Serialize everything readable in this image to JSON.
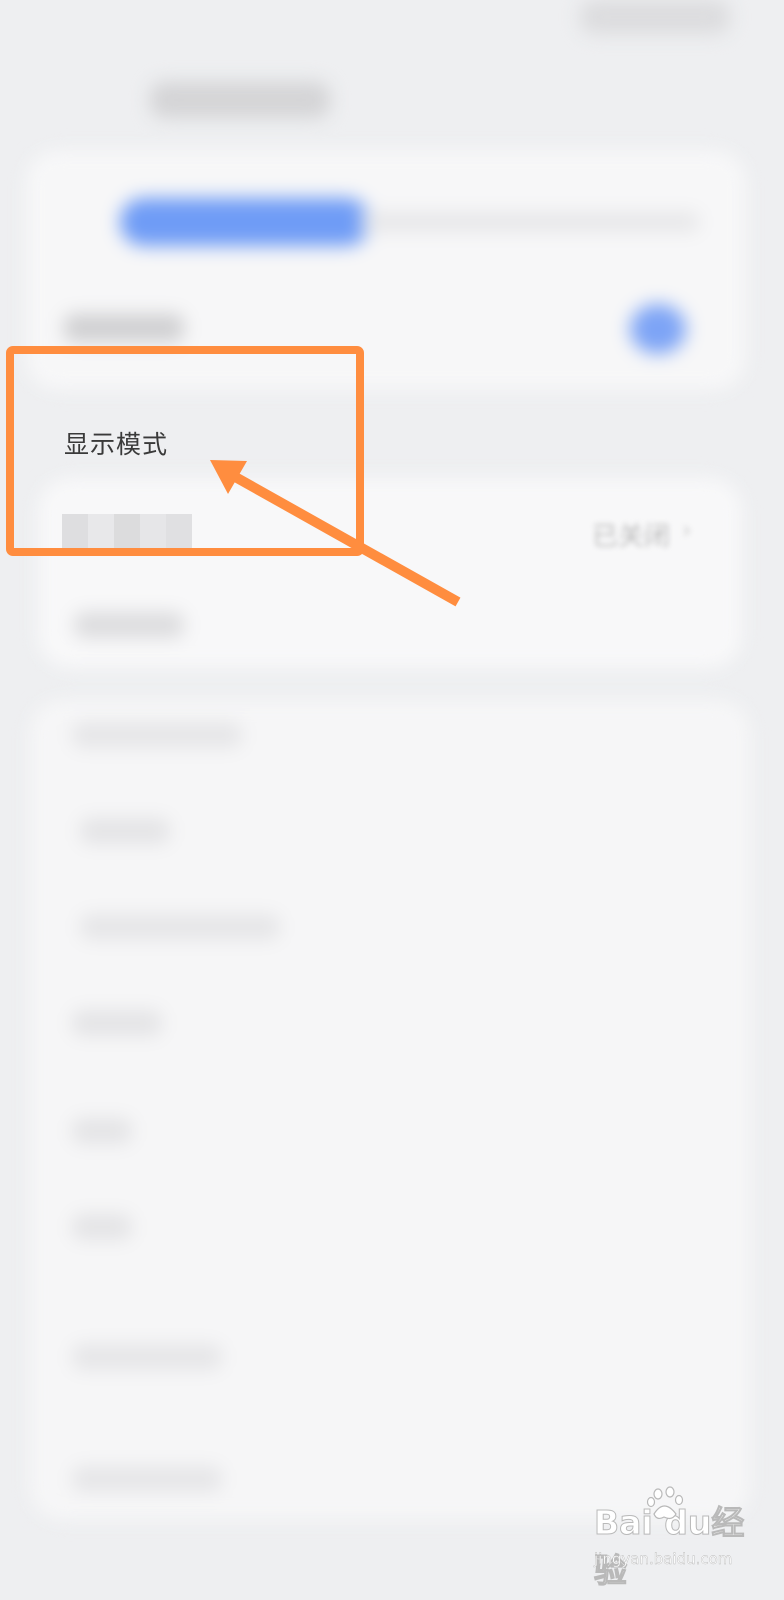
{
  "settings": {
    "section_title": "显示模式",
    "status_value": "已关闭",
    "chevron": "›"
  },
  "accent_color": "#6f9cf6",
  "annotation": {
    "color": "#ff8d3f",
    "shape": "rectangle-with-arrow",
    "icon": "arrow-icon"
  },
  "watermark": {
    "logo_text": "Bai du经验",
    "url": "jingyan.baidu.com",
    "icon": "paw-icon"
  }
}
